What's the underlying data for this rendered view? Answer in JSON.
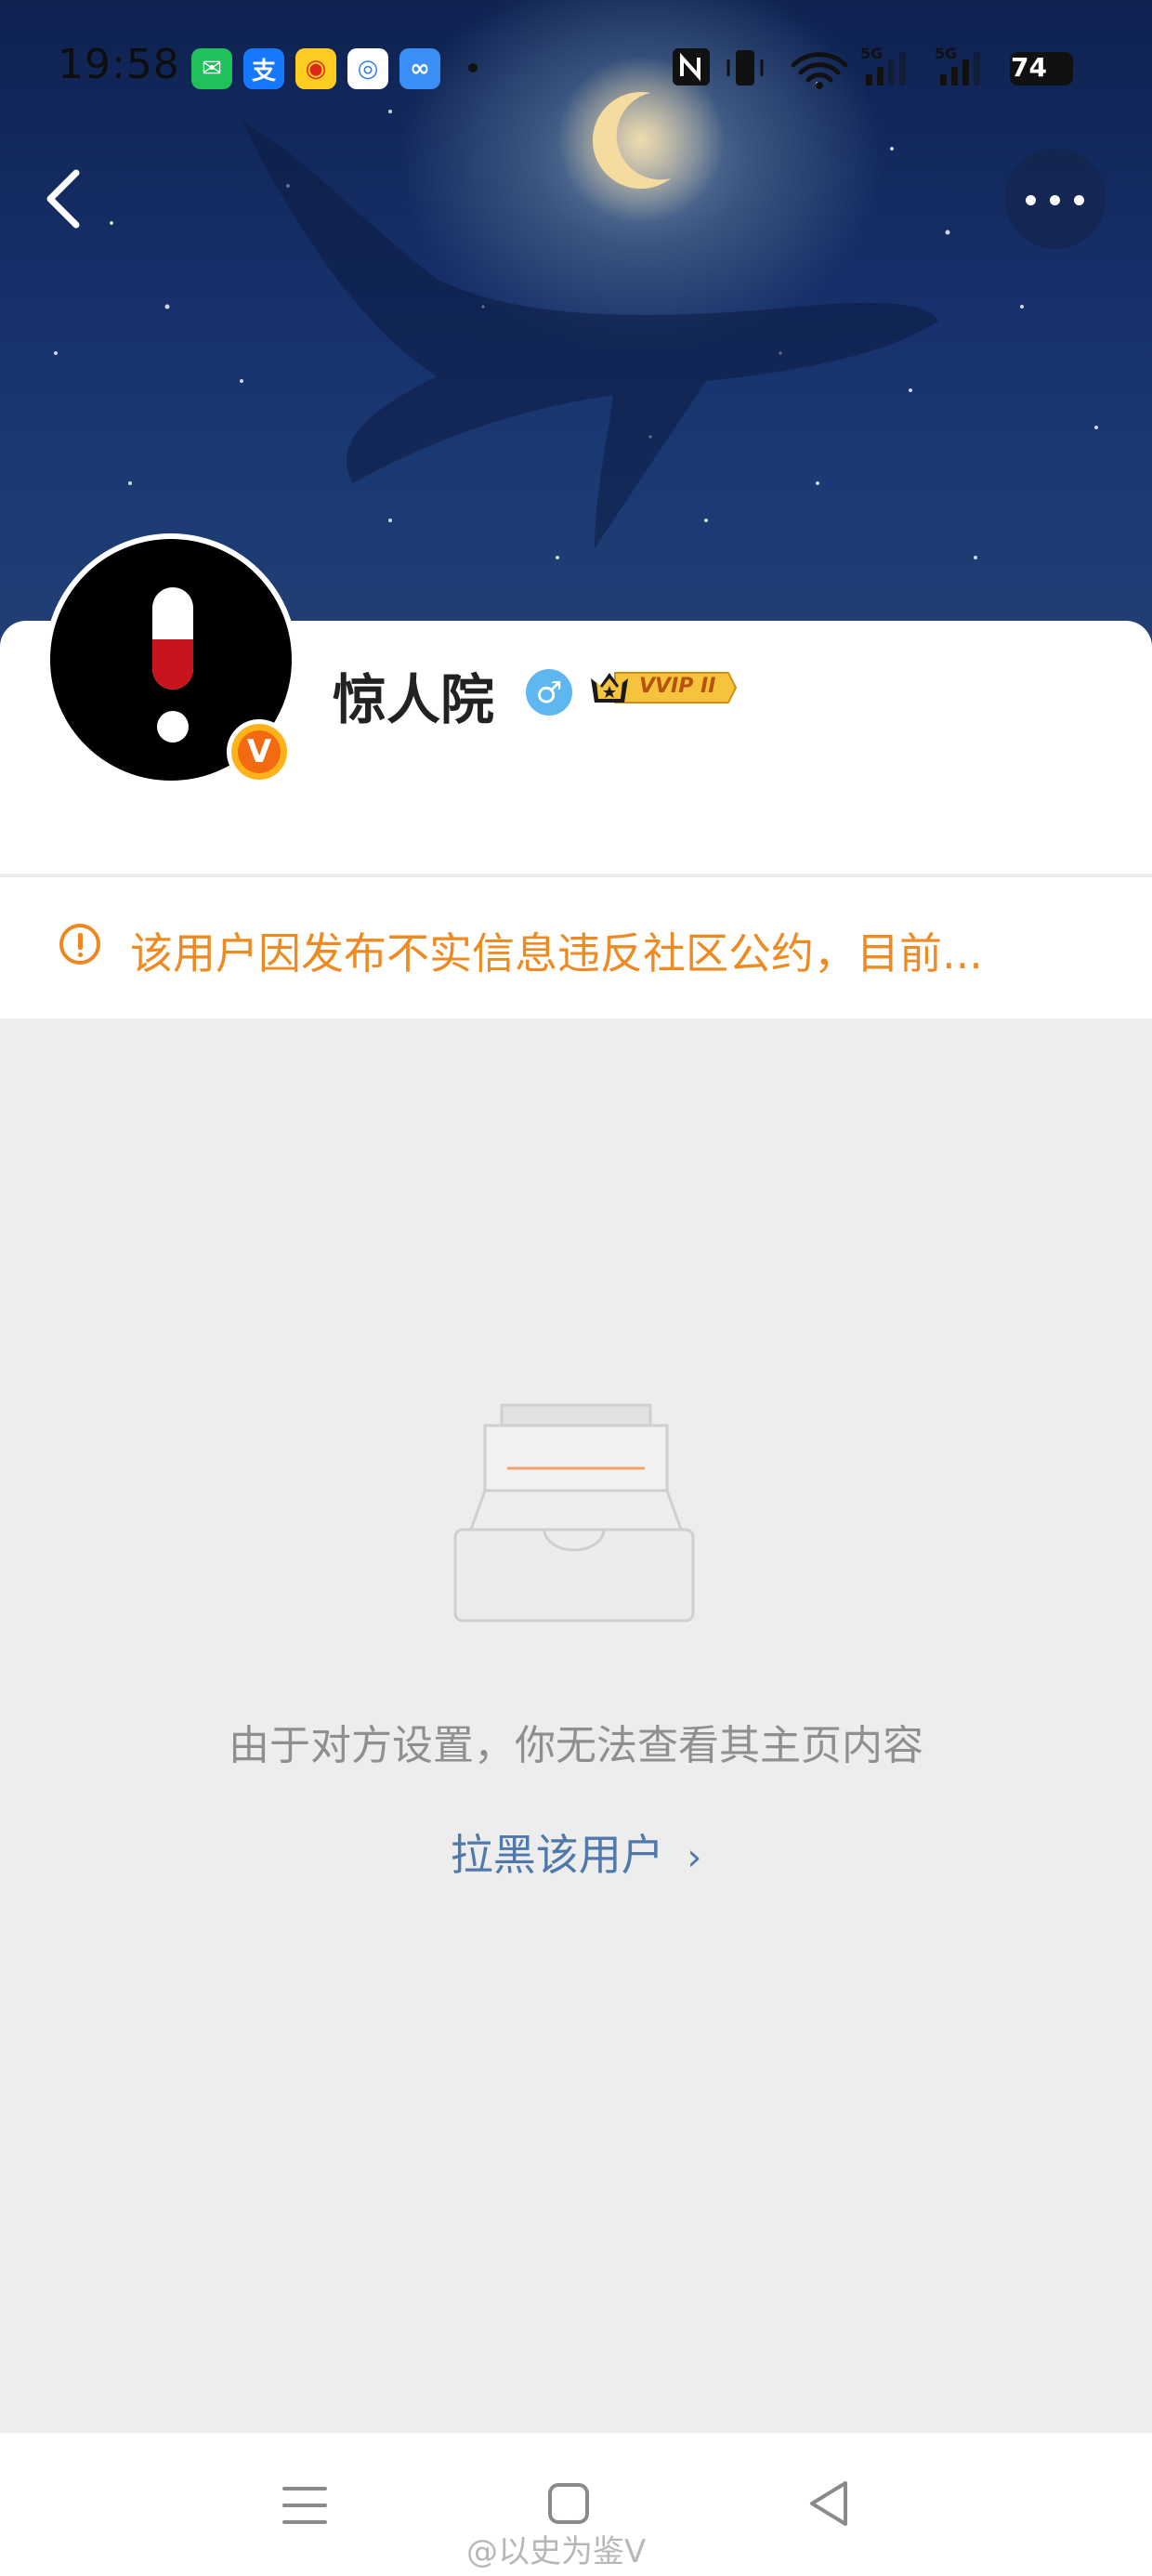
{
  "status_bar": {
    "time": "19:58",
    "notification_icons": [
      "wechat-icon",
      "alipay-icon",
      "weibo-icon",
      "app-icon",
      "baidu-netdisk-icon"
    ],
    "signal_labels": [
      "5G",
      "5G"
    ],
    "battery": "74"
  },
  "header": {
    "back_icon": "chevron-left-icon",
    "more_icon": "more-dots-icon"
  },
  "profile": {
    "name": "惊人院",
    "gender_symbol": "♂",
    "verified_letter": "V",
    "vip_label": "VVIP II"
  },
  "notice": {
    "text": "该用户因发布不实信息违反社区公约，目前..."
  },
  "empty_state": {
    "message": "由于对方设置，你无法查看其主页内容",
    "block_link": "拉黑该用户"
  },
  "nav": {
    "icons": [
      "menu-icon",
      "home-square-icon",
      "back-triangle-icon"
    ]
  },
  "watermark": "@以史为鉴V",
  "colors": {
    "accent_orange": "#ee8a22",
    "link_blue": "#4e79aa",
    "background_gray": "#ededed"
  }
}
